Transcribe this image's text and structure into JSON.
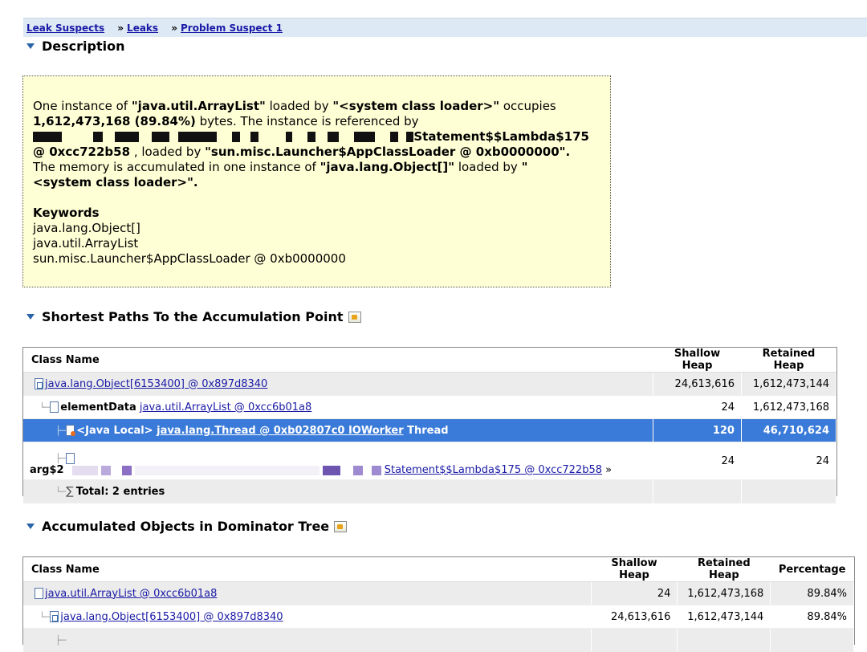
{
  "breadcrumb": {
    "items": [
      "Leak Suspects",
      "Leaks",
      "Problem Suspect 1"
    ],
    "separator": "»"
  },
  "description": {
    "title": "Description",
    "p1": "One instance of ",
    "class1": "\"java.util.ArrayList\"",
    "p2": " loaded by ",
    "loader1": "\"<system class loader>\"",
    "p3": " occupies",
    "bytes": "1,612,473,168 (89.84%)",
    "p4": " bytes. The instance is referenced by",
    "ref_suffix": "Statement$$Lambda$175",
    "ref_addr": "@ 0xcc722b58",
    "p5": " , loaded by ",
    "loader2": "\"sun.misc.Launcher$AppClassLoader @ 0xb0000000\".",
    "p6": "The memory is accumulated in one instance of ",
    "class2": "\"java.lang.Object[]\"",
    "p7": " loaded by ",
    "loader3a": "\"",
    "loader3b": "<system class loader>\".",
    "keywords_title": "Keywords",
    "keywords": [
      "java.lang.Object[]",
      "java.util.ArrayList",
      "sun.misc.Launcher$AppClassLoader @ 0xb0000000"
    ]
  },
  "shortest_paths": {
    "title": "Shortest Paths To the Accumulation Point",
    "columns": [
      "Class Name",
      "Shallow Heap",
      "Retained Heap"
    ],
    "rows": [
      {
        "prefix": "",
        "link": "java.lang.Object[6153400] @ 0x897d8340",
        "suffix": "",
        "shallow": "24,613,616",
        "retained": "1,612,473,144"
      },
      {
        "prefix": "elementData",
        "link": "java.util.ArrayList @ 0xcc6b01a8",
        "suffix": "",
        "shallow": "24",
        "retained": "1,612,473,168"
      },
      {
        "prefix": "<Java Local>",
        "link": "java.lang.Thread @ 0xb02807c0 IOWorker",
        "suffix": "Thread",
        "shallow": "120",
        "retained": "46,710,624"
      },
      {
        "prefix": "arg$2",
        "link": "Statement$$Lambda$175 @ 0xcc722b58",
        "suffix": "»",
        "shallow": "24",
        "retained": "24"
      }
    ],
    "total": "Total: 2 entries"
  },
  "accumulated": {
    "title": "Accumulated Objects in Dominator Tree",
    "columns": [
      "Class Name",
      "Shallow Heap",
      "Retained Heap",
      "Percentage"
    ],
    "rows": [
      {
        "link": "java.util.ArrayList @ 0xcc6b01a8",
        "shallow": "24",
        "retained": "1,612,473,168",
        "pct": "89.84%"
      },
      {
        "link": "java.lang.Object[6153400] @ 0x897d8340",
        "shallow": "24,613,616",
        "retained": "1,612,473,144",
        "pct": "89.84%"
      }
    ]
  },
  "colors": {
    "selected_row": "#3a7ad8",
    "box_bg": "#ffffd6",
    "link": "#1a1aa6",
    "breadcrumb_bg": "#dde9f5"
  }
}
